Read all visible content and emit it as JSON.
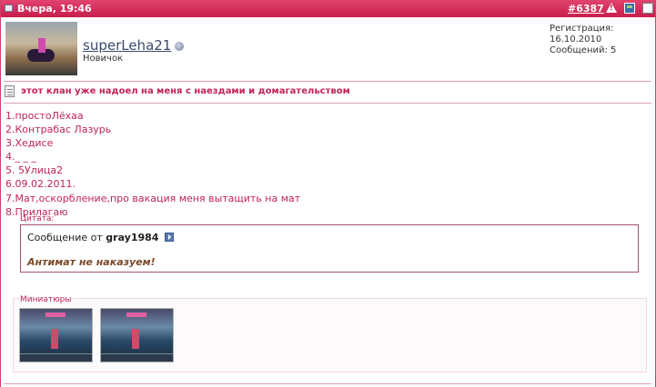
{
  "header": {
    "date": "Вчера, 19:46",
    "post_number": "#6387",
    "icons": [
      "post-icon",
      "warning-icon",
      "report-icon",
      "multiquote-icon"
    ]
  },
  "user": {
    "name": "superLeha21",
    "rank": "Новичок",
    "registration": "Регистрация: 16.10.2010",
    "messages": "Сообщений: 5",
    "status_icon": "online-status-icon"
  },
  "post": {
    "title": "этот клан уже надоел на меня с наездами и домагательством",
    "lines": [
      "1.простоЛёхаа",
      "2.Контрабас Лазурь",
      "3.Хедисе",
      "4._ _ _",
      "5. 5Улица2",
      "6.09.02.2011.",
      "7.Мат,оскорбление,про вакация меня вытащить на мат",
      "8.Прилагаю"
    ]
  },
  "quote": {
    "label": "Цитата:",
    "from_prefix": "Сообщение от",
    "author": "gray1984",
    "text": "Антимат не наказуем!"
  },
  "attachments": {
    "label": "Миниатюры",
    "thumbnails": [
      "thumbnail-1",
      "thumbnail-2"
    ]
  },
  "colors": {
    "accent": "#c81e4c",
    "text_accent": "#c0245a",
    "quote_text": "#7a4a2a"
  }
}
